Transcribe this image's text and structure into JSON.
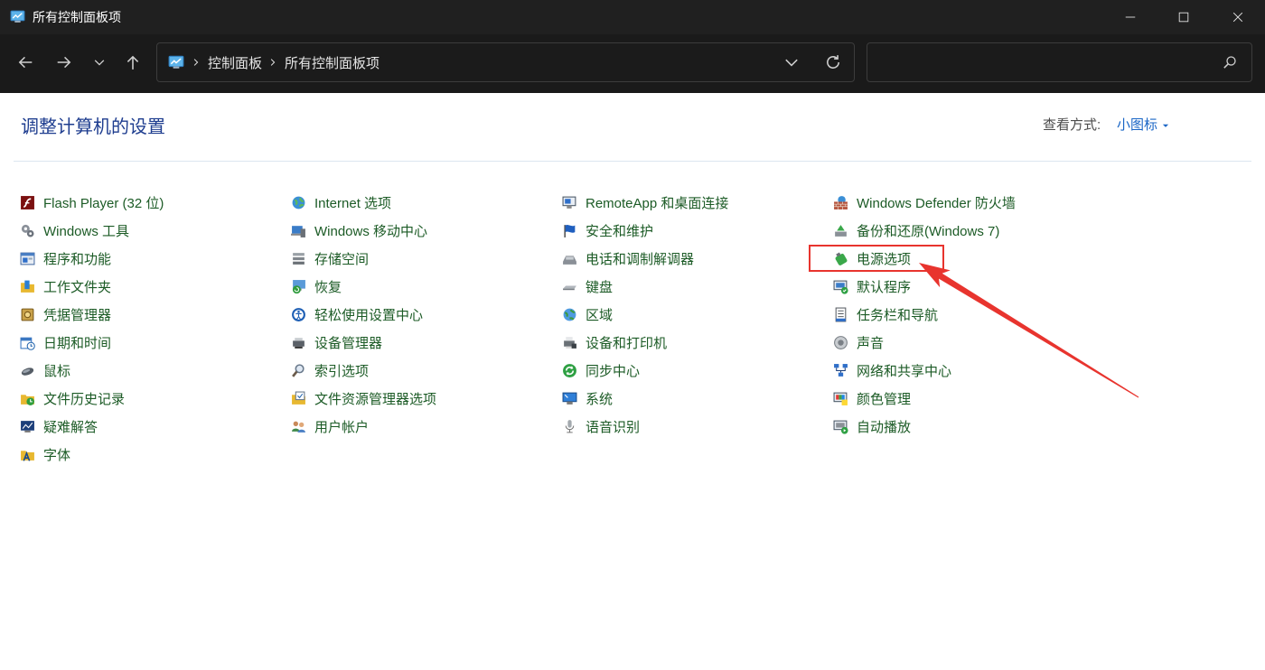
{
  "window": {
    "title": "所有控制面板项",
    "app_icon": "control-panel-icon",
    "controls": {
      "minimize": "minimize-icon",
      "maximize": "maximize-icon",
      "close": "close-icon"
    }
  },
  "nav": {
    "back": "back-arrow-icon",
    "forward": "forward-arrow-icon",
    "recent": "recent-locations-chevron-icon",
    "up": "up-arrow-icon"
  },
  "address_bar": {
    "location_icon": "control-panel-icon",
    "separator_icon": "chevron-right-icon",
    "breadcrumbs": [
      "控制面板",
      "所有控制面板项"
    ],
    "dropdown_icon": "chevron-down-icon",
    "refresh_icon": "refresh-icon"
  },
  "search": {
    "value": "",
    "icon": "search-icon"
  },
  "header": {
    "title": "调整计算机的设置",
    "view_by_label": "查看方式:",
    "view_mode": "小图标",
    "view_mode_icon": "dropdown-triangle-icon"
  },
  "items": {
    "columns": [
      [
        {
          "label": "Flash Player (32 位)",
          "icon": "flash-player-icon"
        },
        {
          "label": "Windows 工具",
          "icon": "windows-tools-icon"
        },
        {
          "label": "程序和功能",
          "icon": "programs-features-icon"
        },
        {
          "label": "工作文件夹",
          "icon": "work-folders-icon"
        },
        {
          "label": "凭据管理器",
          "icon": "credential-manager-icon"
        },
        {
          "label": "日期和时间",
          "icon": "date-time-icon"
        },
        {
          "label": "鼠标",
          "icon": "mouse-icon"
        },
        {
          "label": "文件历史记录",
          "icon": "file-history-icon"
        },
        {
          "label": "疑难解答",
          "icon": "troubleshooting-icon"
        },
        {
          "label": "字体",
          "icon": "fonts-icon"
        }
      ],
      [
        {
          "label": "Internet 选项",
          "icon": "internet-options-icon"
        },
        {
          "label": "Windows 移动中心",
          "icon": "mobility-center-icon"
        },
        {
          "label": "存储空间",
          "icon": "storage-spaces-icon"
        },
        {
          "label": "恢复",
          "icon": "recovery-icon"
        },
        {
          "label": "轻松使用设置中心",
          "icon": "ease-of-access-icon"
        },
        {
          "label": "设备管理器",
          "icon": "device-manager-icon"
        },
        {
          "label": "索引选项",
          "icon": "indexing-options-icon"
        },
        {
          "label": "文件资源管理器选项",
          "icon": "file-explorer-options-icon"
        },
        {
          "label": "用户帐户",
          "icon": "user-accounts-icon"
        }
      ],
      [
        {
          "label": "RemoteApp 和桌面连接",
          "icon": "remoteapp-icon"
        },
        {
          "label": "安全和维护",
          "icon": "security-maintenance-icon"
        },
        {
          "label": "电话和调制解调器",
          "icon": "phone-modem-icon"
        },
        {
          "label": "键盘",
          "icon": "keyboard-icon"
        },
        {
          "label": "区域",
          "icon": "region-icon"
        },
        {
          "label": "设备和打印机",
          "icon": "devices-printers-icon"
        },
        {
          "label": "同步中心",
          "icon": "sync-center-icon"
        },
        {
          "label": "系统",
          "icon": "system-icon"
        },
        {
          "label": "语音识别",
          "icon": "speech-recognition-icon"
        }
      ],
      [
        {
          "label": "Windows Defender 防火墙",
          "icon": "firewall-icon"
        },
        {
          "label": "备份和还原(Windows 7)",
          "icon": "backup-restore-icon"
        },
        {
          "label": "电源选项",
          "icon": "power-options-icon",
          "highlighted": true
        },
        {
          "label": "默认程序",
          "icon": "default-programs-icon"
        },
        {
          "label": "任务栏和导航",
          "icon": "taskbar-navigation-icon"
        },
        {
          "label": "声音",
          "icon": "sound-icon"
        },
        {
          "label": "网络和共享中心",
          "icon": "network-sharing-icon"
        },
        {
          "label": "颜色管理",
          "icon": "color-management-icon"
        },
        {
          "label": "自动播放",
          "icon": "autoplay-icon"
        }
      ]
    ]
  },
  "colors": {
    "title_bar": "#202020",
    "nav_bar": "#1a1a1a",
    "heading": "#1e3d8f",
    "link": "#1a66c6",
    "item_text": "#1c5b26",
    "annotation": "#e8342e"
  }
}
